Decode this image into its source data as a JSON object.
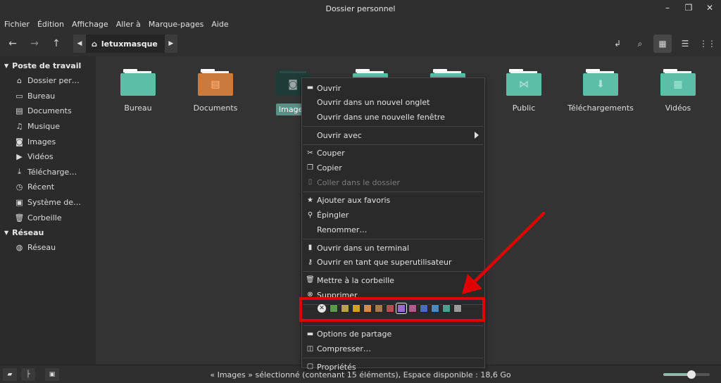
{
  "window": {
    "title": "Dossier personnel"
  },
  "menu": [
    "Fichier",
    "Édition",
    "Affichage",
    "Aller à",
    "Marque-pages",
    "Aide"
  ],
  "breadcrumb": {
    "current": "letuxmasque"
  },
  "sidebar": {
    "sections": [
      {
        "title": "Poste de travail",
        "items": [
          {
            "label": "Dossier per…",
            "icon": "home-icon"
          },
          {
            "label": "Bureau",
            "icon": "desktop-icon"
          },
          {
            "label": "Documents",
            "icon": "document-icon"
          },
          {
            "label": "Musique",
            "icon": "music-icon"
          },
          {
            "label": "Images",
            "icon": "camera-icon"
          },
          {
            "label": "Vidéos",
            "icon": "video-icon"
          },
          {
            "label": "Télécharge…",
            "icon": "download-icon"
          },
          {
            "label": "Récent",
            "icon": "clock-icon"
          },
          {
            "label": "Système de…",
            "icon": "drive-icon"
          },
          {
            "label": "Corbeille",
            "icon": "trash-icon"
          }
        ]
      },
      {
        "title": "Réseau",
        "items": [
          {
            "label": "Réseau",
            "icon": "globe-icon"
          }
        ]
      }
    ]
  },
  "files": [
    {
      "name": "Bureau",
      "color": "#5bbfa8",
      "icon": "desktop-folder-icon"
    },
    {
      "name": "Documents",
      "color": "#c97a3c",
      "icon": "documents-folder-icon"
    },
    {
      "name": "Images",
      "color": "#1e3b35",
      "icon": "images-folder-icon",
      "selected": true
    },
    {
      "name": "",
      "color": "#5bbfa8",
      "icon": "folder-icon"
    },
    {
      "name": "",
      "color": "#5bbfa8",
      "icon": "folder-icon"
    },
    {
      "name": "Public",
      "color": "#5bbfa8",
      "icon": "public-folder-icon"
    },
    {
      "name": "Téléchargements",
      "color": "#5bbfa8",
      "icon": "downloads-folder-icon"
    },
    {
      "name": "Vidéos",
      "color": "#5bbfa8",
      "icon": "videos-folder-icon"
    }
  ],
  "context_menu": {
    "items": [
      {
        "label": "Ouvrir",
        "icon": "folder-open-icon"
      },
      {
        "label": "Ouvrir dans un nouvel onglet"
      },
      {
        "label": "Ouvrir dans une nouvelle fenêtre"
      },
      {
        "sep": true
      },
      {
        "label": "Ouvrir avec",
        "submenu": true
      },
      {
        "sep": true
      },
      {
        "label": "Couper",
        "icon": "scissors-icon"
      },
      {
        "label": "Copier",
        "icon": "copy-icon"
      },
      {
        "label": "Coller dans le dossier",
        "icon": "clipboard-icon",
        "disabled": true
      },
      {
        "sep": true
      },
      {
        "label": "Ajouter aux favoris",
        "icon": "star-icon"
      },
      {
        "label": "Épingler",
        "icon": "pin-icon"
      },
      {
        "label": "Renommer…"
      },
      {
        "sep": true
      },
      {
        "label": "Ouvrir dans un terminal",
        "icon": "terminal-icon"
      },
      {
        "label": "Ouvrir en tant que superutilisateur",
        "icon": "key-icon"
      },
      {
        "sep": true
      },
      {
        "label": "Mettre à la corbeille",
        "icon": "trash-icon"
      },
      {
        "label": "Supprimer",
        "icon": "delete-icon"
      },
      {
        "sep": true
      },
      {
        "tags": true
      },
      {
        "sep": true
      },
      {
        "label": "Options de partage",
        "icon": "share-folder-icon"
      },
      {
        "label": "Compresser…",
        "icon": "archive-icon"
      },
      {
        "sep": true
      },
      {
        "label": "Propriétés",
        "icon": "properties-icon"
      }
    ],
    "tag_colors": [
      "#5a9a4a",
      "#b8a04c",
      "#d0a020",
      "#d48a4a",
      "#a77a4a",
      "#b05050",
      "#9a6ad0",
      "#b05a90",
      "#4a6ac0",
      "#4a8ac0",
      "#4aa090",
      "#9a9a9a"
    ],
    "tag_picked_index": 6
  },
  "status": {
    "text": "« Images » sélectionné (contenant 15 éléments), Espace disponible : 18,6 Go",
    "zoom": 0.6
  }
}
